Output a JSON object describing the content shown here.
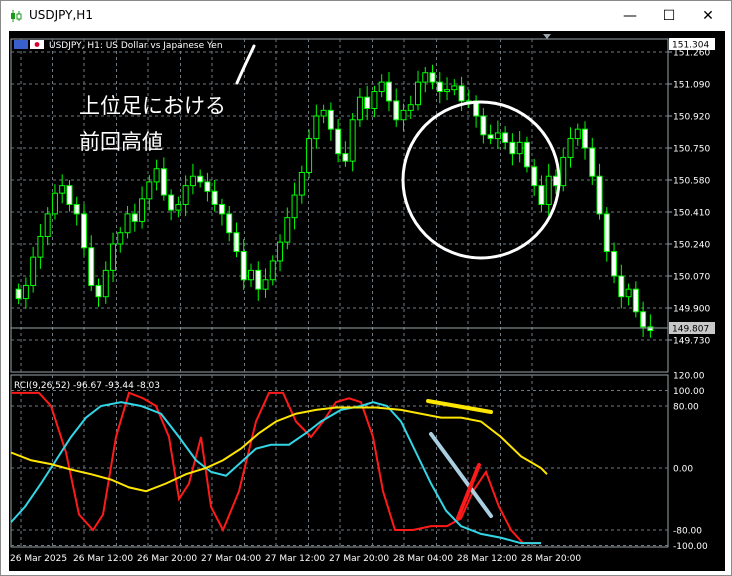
{
  "window": {
    "title": "USDJPY,H1",
    "min_glyph": "—",
    "max_glyph": "☐",
    "close_glyph": "✕"
  },
  "main": {
    "symbol_info": "USDJPY, H1:  US Dollar vs Japanese Yen",
    "current_price": "151.304",
    "last_price": "149.807",
    "y_ticks": [
      "151.260",
      "151.090",
      "150.920",
      "150.750",
      "150.580",
      "150.410",
      "150.240",
      "150.070",
      "149.900",
      "149.730"
    ],
    "annotation_line1": "上位足における",
    "annotation_line2": "前回高値"
  },
  "indicator": {
    "label": "RCI(9,26,52) -96.67 -93.44 -8.03",
    "y_ticks": [
      "120.00",
      "100.00",
      "80.00",
      "0.00",
      "-80.00",
      "-100.00"
    ]
  },
  "x_axis": {
    "labels": [
      "26 Mar 2025",
      "26 Mar 12:00",
      "26 Mar 20:00",
      "27 Mar 04:00",
      "27 Mar 12:00",
      "27 Mar 20:00",
      "28 Mar 04:00",
      "28 Mar 12:00",
      "28 Mar 20:00"
    ]
  },
  "colors": {
    "background": "#000000",
    "grid": "#6f7a82",
    "candle": "#00ff00",
    "candle_up_fill": "#000000",
    "candle_down_fill": "#ffffff",
    "rci_short": "#ff1a1a",
    "rci_mid": "#33d6e6",
    "rci_long": "#ffe600",
    "annotation": "#ffffff"
  }
}
